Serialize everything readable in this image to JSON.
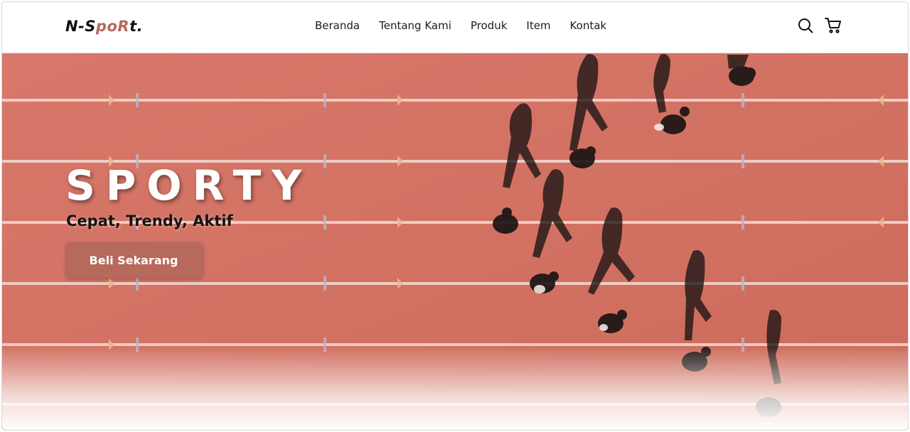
{
  "brand": {
    "logo_prefix": "N-S",
    "logo_accent": "poR",
    "logo_suffix": "t.",
    "accent_color": "#b7695c"
  },
  "nav": {
    "items": [
      {
        "label": "Beranda"
      },
      {
        "label": "Tentang Kami"
      },
      {
        "label": "Produk"
      },
      {
        "label": "Item"
      },
      {
        "label": "Kontak"
      }
    ],
    "icons": [
      "search-icon",
      "cart-icon"
    ]
  },
  "hero": {
    "title": "SPORTY",
    "tagline": "Cepat, Trendy, Aktif",
    "cta_label": "Beli Sekarang",
    "background_color": "#d2705f"
  }
}
